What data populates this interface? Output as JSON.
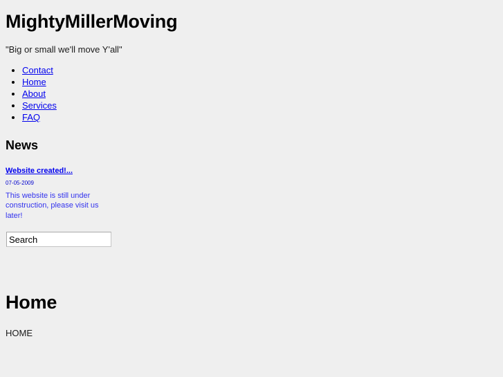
{
  "site": {
    "title": "MightyMillerMoving",
    "tagline": "\"Big or small we'll move Y'all\""
  },
  "nav": {
    "items": [
      {
        "label": "Contact"
      },
      {
        "label": "Home"
      },
      {
        "label": "About"
      },
      {
        "label": "Services"
      },
      {
        "label": "FAQ"
      }
    ]
  },
  "news": {
    "heading": "News",
    "items": [
      {
        "headline": "Website created!...",
        "date": "07-05-2009",
        "body": "This website is still under construction, please visit us later!"
      }
    ]
  },
  "search": {
    "value": "Search",
    "placeholder": "Search"
  },
  "content": {
    "heading": "Home",
    "body": "HOME"
  },
  "colors": {
    "background": "#efefef",
    "link": "#0000ee",
    "news_text": "#3333ee",
    "text": "#000000",
    "input_background": "#ffffff",
    "input_border": "#a9a9a9"
  }
}
